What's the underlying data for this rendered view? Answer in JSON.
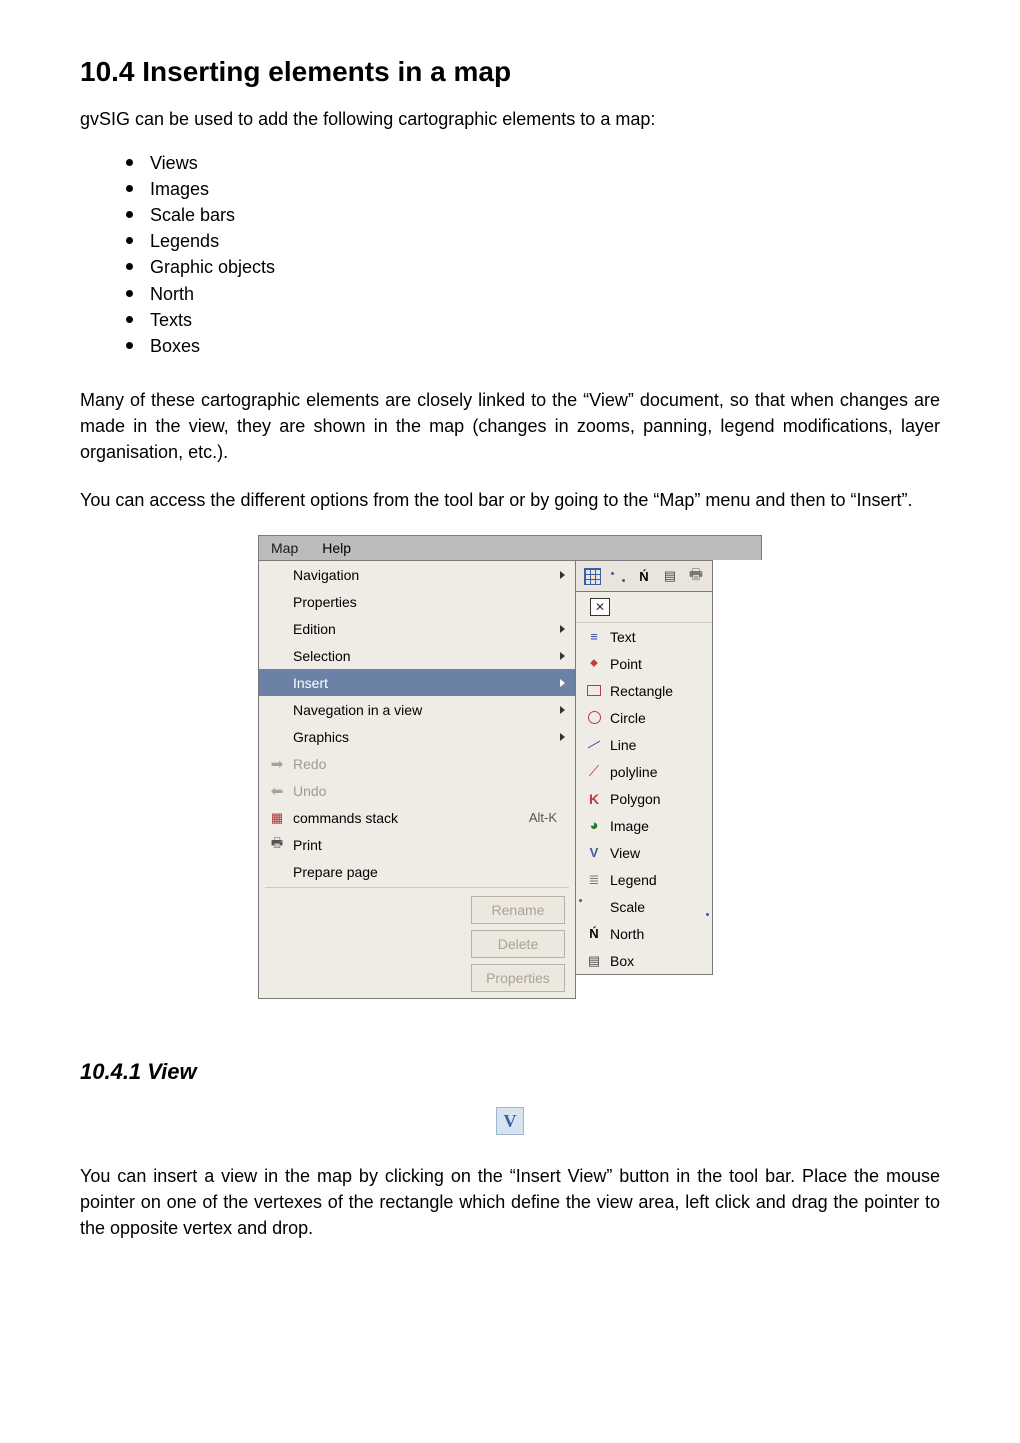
{
  "heading": "10.4 Inserting elements in a map",
  "intro": "gvSIG can be used to add the following cartographic elements to a map:",
  "cart_list": [
    "Views",
    "Images",
    "Scale bars",
    "Legends",
    "Graphic objects",
    "North",
    "Texts",
    "Boxes"
  ],
  "para1": "Many of these cartographic elements are closely linked to the “View” document, so that when changes are made in the view, they are shown in the map (changes in zooms, panning, legend modifications, layer organisation, etc.).",
  "para2": "You can access the different options from the tool bar or by going to the “Map” menu and then to “Insert”.",
  "menubar": {
    "map": "Map",
    "help": "Help"
  },
  "menu_main": {
    "navigation": "Navigation",
    "properties": "Properties",
    "edition": "Edition",
    "selection": "Selection",
    "insert": "Insert",
    "nav_in_view": "Navegation in a view",
    "graphics": "Graphics",
    "redo": "Redo",
    "undo": "Undo",
    "commands_stack": "commands stack",
    "commands_stack_accel": "Alt-K",
    "print": "Print",
    "prepare_page": "Prepare page",
    "btn_rename": "Rename",
    "btn_delete": "Delete",
    "btn_properties": "Properties"
  },
  "menu_insert": {
    "text": "Text",
    "point": "Point",
    "rectangle": "Rectangle",
    "circle": "Circle",
    "line": "Line",
    "polyline": "polyline",
    "polygon": "Polygon",
    "image": "Image",
    "view": "View",
    "legend": "Legend",
    "scale": "Scale",
    "north": "North",
    "box": "Box"
  },
  "close_symbol": "✕",
  "subheading": "10.4.1 View",
  "view_icon_label": "V",
  "para3": "You can insert a view in the map by clicking on the “Insert View” button in the tool bar. Place the mouse pointer on one of the vertexes of the rectangle which define the view area, left click and drag the pointer to the opposite vertex and drop."
}
